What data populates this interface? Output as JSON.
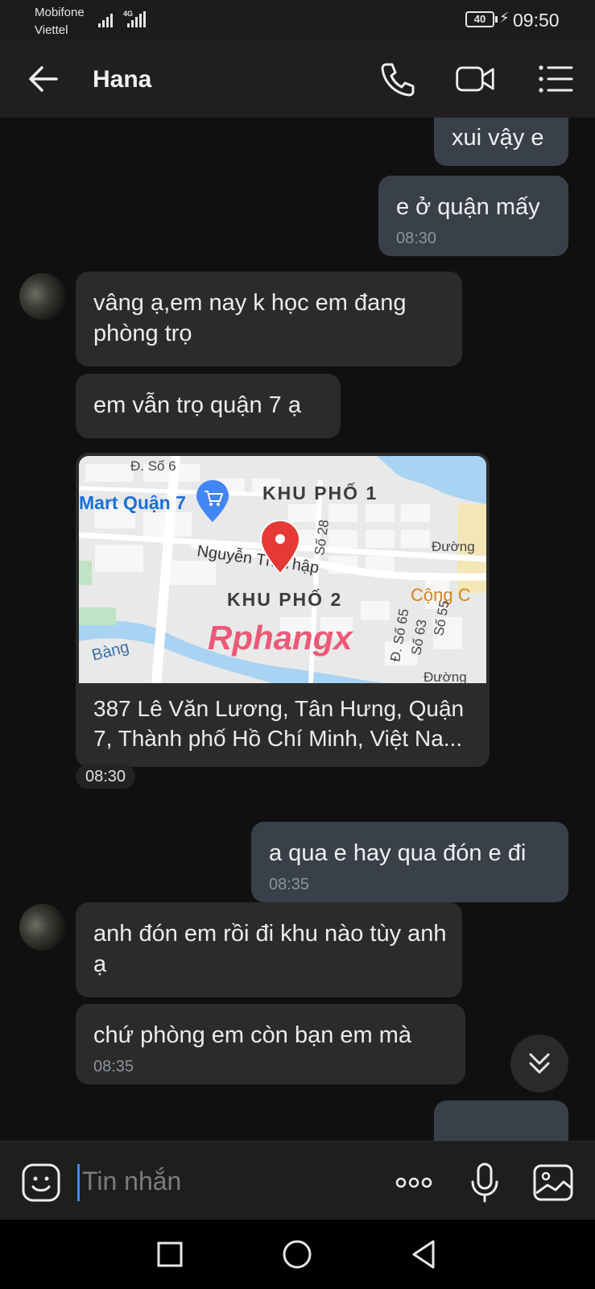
{
  "status_bar": {
    "carrier_1": "Mobifone",
    "carrier_2": "Viettel",
    "network": "4G",
    "battery": "40",
    "time": "09:50"
  },
  "header": {
    "contact_name": "Hana",
    "icons": [
      "back-arrow-icon",
      "phone-icon",
      "video-call-icon",
      "menu-icon"
    ]
  },
  "messages": [
    {
      "direction": "out",
      "text": "xui vậy e"
    },
    {
      "direction": "out",
      "text": "e ở quận mấy",
      "time": "08:30"
    },
    {
      "direction": "in",
      "text": "vâng ạ,em nay k học em đang phòng trọ"
    },
    {
      "direction": "in",
      "text": "em vẫn trọ quận 7 ạ"
    },
    {
      "direction": "in",
      "type": "location",
      "map_labels": {
        "street_top": "Đ. Số 6",
        "mart": "Mart Quận 7",
        "khu_pho_1": "KHU PHỐ 1",
        "so_28": "Số 28",
        "duong": "Đường",
        "nguyen_thi_thap": "Nguyễn Thị Thập",
        "khu_pho_2": "KHU PHỐ 2",
        "cong": "Cộng C",
        "bang": "Bàng",
        "so_65": "Đ. Số 65",
        "so_63": "Số 63",
        "so_55": "Số 55",
        "duong_bottom": "Đường",
        "watermark": "Rphangx"
      },
      "address": "387 Lê Văn Lương, Tân Hưng, Quận 7, Thành phố Hồ Chí Minh, Việt Na...",
      "time": "08:30"
    },
    {
      "direction": "out",
      "text": "a qua e hay qua đón e đi",
      "time": "08:35"
    },
    {
      "direction": "in",
      "text": "anh đón em rồi đi khu nào tùy anh ạ"
    },
    {
      "direction": "in",
      "text": "chứ phòng em còn bạn em mà",
      "time": "08:35"
    }
  ],
  "composer": {
    "placeholder": "Tin nhắn",
    "icons": [
      "emoji-icon",
      "more-options-icon",
      "microphone-icon",
      "gallery-icon"
    ]
  },
  "colors": {
    "background": "#101010",
    "outgoing_bubble": "#3a4049",
    "incoming_bubble": "#2b2b2b",
    "caret": "#3c8fe8",
    "map_pin": "#e53935"
  }
}
